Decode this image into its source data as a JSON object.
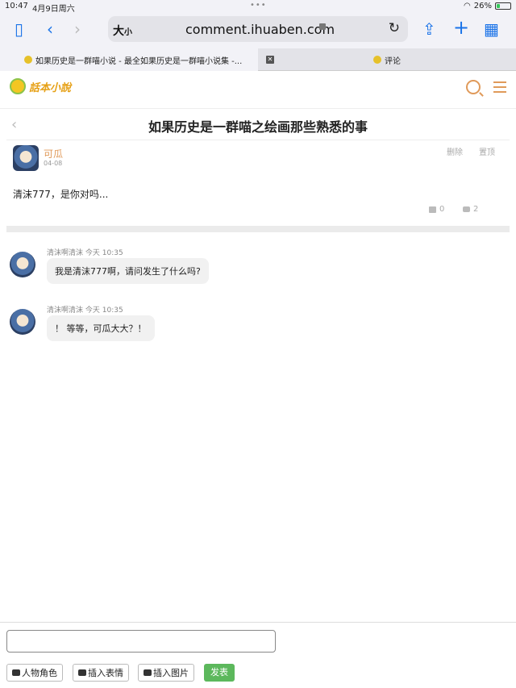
{
  "status_bar": {
    "time": "10:47",
    "date": "4月9日周六",
    "battery": "26%",
    "battery_level": 0.26
  },
  "browser": {
    "text_size_button": "大",
    "text_size_small": "小",
    "url": "comment.ihuaben.com",
    "tabs": [
      {
        "label": "如果历史是一群喵小说 - 最全如果历史是一群喵小说集 -...",
        "active": true
      },
      {
        "label": "评论",
        "active": false
      }
    ]
  },
  "site": {
    "logo_text": "話本小說",
    "page_title": "如果历史是一群喵之绘画那些熟悉的事"
  },
  "post": {
    "author": "可瓜",
    "date": "04-08",
    "delete_label": "删除",
    "pin_label": "置顶",
    "content": "清沫777，是你对吗...",
    "like_count": "0",
    "reply_count": "2"
  },
  "comments": [
    {
      "user": "清沫啊清沫",
      "time": "今天 10:35",
      "text": "我是清沫777啊，请问发生了什么吗?"
    },
    {
      "user": "清沫啊清沫",
      "time": "今天 10:35",
      "text": "！ 等等，可瓜大大？！"
    }
  ],
  "composer": {
    "input_placeholder": "",
    "btn_character": "人物角色",
    "btn_emoji": "插入表情",
    "btn_image": "插入图片",
    "btn_send": "发表"
  },
  "colors": {
    "accent": "#e09a5a",
    "send_button": "#5cb85c",
    "link_blue": "#1a73e8"
  }
}
